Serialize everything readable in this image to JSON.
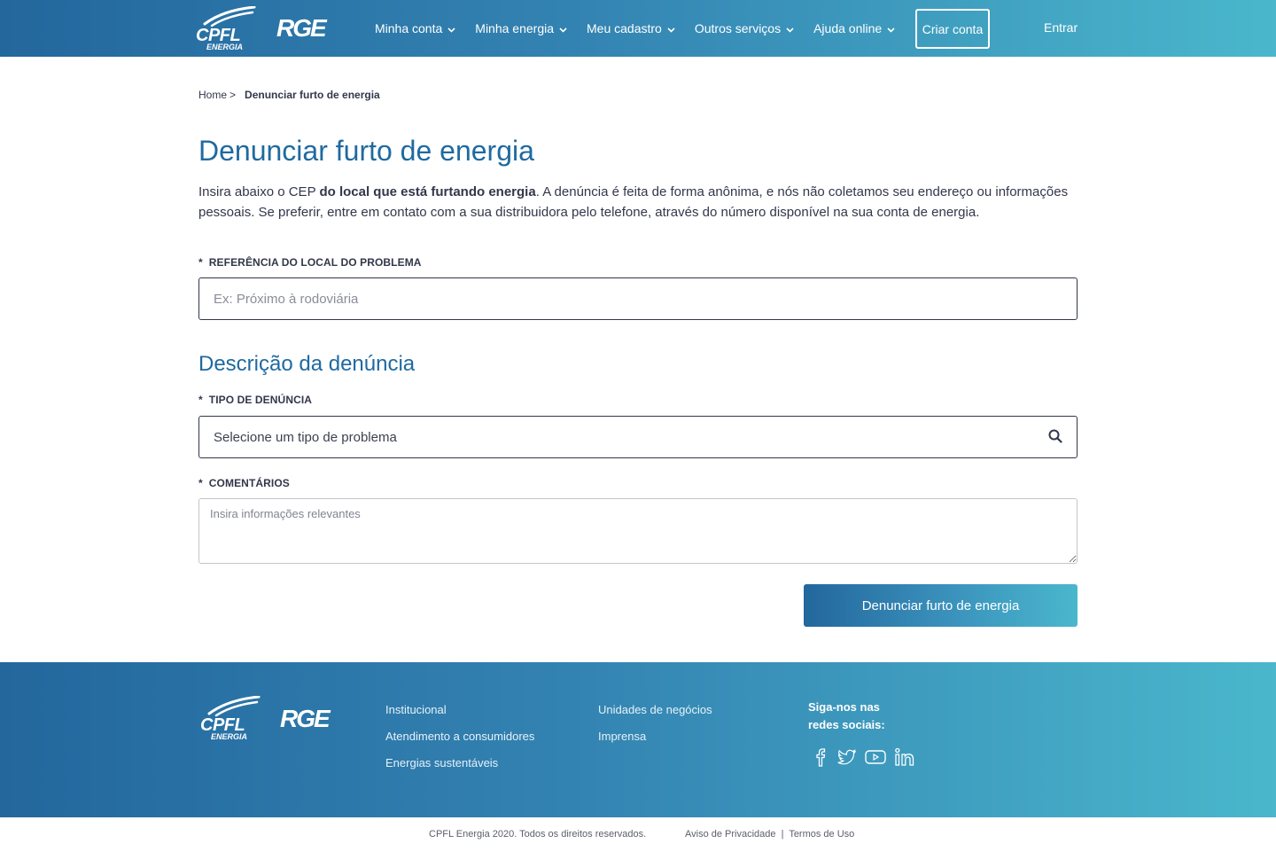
{
  "header": {
    "logo_cpfl": "CPFL",
    "logo_cpfl_sub": "ENERGIA",
    "logo_rge": "RGE",
    "nav": [
      {
        "label": "Minha conta"
      },
      {
        "label": "Minha energia"
      },
      {
        "label": "Meu cadastro"
      },
      {
        "label": "Outros serviços"
      },
      {
        "label": "Ajuda online"
      }
    ],
    "criar_conta": "Criar conta",
    "entrar": "Entrar"
  },
  "breadcrumb": {
    "home": "Home",
    "separator": ">",
    "current": "Denunciar furto de energia"
  },
  "page": {
    "title": "Denunciar furto de energia",
    "intro_1": "Insira abaixo o CEP ",
    "intro_bold": "do local que está furtando energia",
    "intro_2": ". A denúncia é feita de forma anônima, e nós não coletamos seu endereço ou informações pessoais. Se preferir, entre em contato com a sua distribuidora pelo telefone, através do número disponível na sua conta de energia."
  },
  "form": {
    "required_mark": "*",
    "referencia_label": "Referência do local do problema",
    "referencia_placeholder": "Ex: Próximo à rodoviária",
    "section_title": "Descrição da denúncia",
    "tipo_label": "Tipo de denúncia",
    "tipo_placeholder": "Selecione um tipo de problema",
    "comentarios_label": "Comentários",
    "comentarios_placeholder": "Insira informações relevantes",
    "submit": "Denunciar furto de energia"
  },
  "footer": {
    "logo_cpfl": "CPFL",
    "logo_cpfl_sub": "ENERGIA",
    "logo_rge": "RGE",
    "col1": [
      "Institucional",
      "Atendimento a consumidores",
      "Energias sustentáveis"
    ],
    "col2": [
      "Unidades de negócios",
      "Imprensa"
    ],
    "social_title": "Siga-nos nas redes sociais:",
    "social_icons": [
      "facebook-icon",
      "twitter-icon",
      "youtube-icon",
      "linkedin-icon"
    ]
  },
  "bottom": {
    "copyright": "CPFL Energia 2020. Todos os direitos reservados.",
    "privacy": "Aviso de Privacidade",
    "divider": "|",
    "terms": "Termos de Uso"
  },
  "colors": {
    "primary": "#1f6aa0",
    "gradient_start": "#23679d",
    "gradient_end": "#4ab7cc",
    "text": "#32374a"
  }
}
